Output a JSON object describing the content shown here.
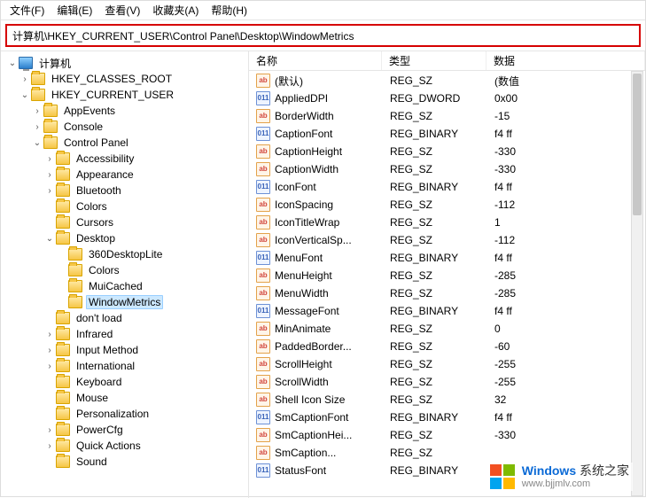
{
  "menu": {
    "file": "文件(F)",
    "edit": "编辑(E)",
    "view": "查看(V)",
    "fav": "收藏夹(A)",
    "help": "帮助(H)"
  },
  "address": "计算机\\HKEY_CURRENT_USER\\Control Panel\\Desktop\\WindowMetrics",
  "tree": {
    "root": "计算机",
    "hkcr": "HKEY_CLASSES_ROOT",
    "hkcu": "HKEY_CURRENT_USER",
    "appevents": "AppEvents",
    "console": "Console",
    "cpanel": "Control Panel",
    "access": "Accessibility",
    "appear": "Appearance",
    "bluetooth": "Bluetooth",
    "colors": "Colors",
    "cursors": "Cursors",
    "desktop": "Desktop",
    "d360": "360DesktopLite",
    "dcolors": "Colors",
    "mui": "MuiCached",
    "wm": "WindowMetrics",
    "dontload": "don't load",
    "infrared": "Infrared",
    "inputm": "Input Method",
    "intl": "International",
    "kbd": "Keyboard",
    "mouse": "Mouse",
    "pers": "Personalization",
    "power": "PowerCfg",
    "qa": "Quick Actions",
    "sound": "Sound"
  },
  "columns": {
    "name": "名称",
    "type": "类型",
    "data": "数据"
  },
  "values": [
    {
      "icon": "str",
      "name": "(默认)",
      "type": "REG_SZ",
      "data": "(数值"
    },
    {
      "icon": "bin",
      "name": "AppliedDPI",
      "type": "REG_DWORD",
      "data": "0x00"
    },
    {
      "icon": "str",
      "name": "BorderWidth",
      "type": "REG_SZ",
      "data": "-15"
    },
    {
      "icon": "bin",
      "name": "CaptionFont",
      "type": "REG_BINARY",
      "data": "f4 ff"
    },
    {
      "icon": "str",
      "name": "CaptionHeight",
      "type": "REG_SZ",
      "data": "-330"
    },
    {
      "icon": "str",
      "name": "CaptionWidth",
      "type": "REG_SZ",
      "data": "-330"
    },
    {
      "icon": "bin",
      "name": "IconFont",
      "type": "REG_BINARY",
      "data": "f4 ff"
    },
    {
      "icon": "str",
      "name": "IconSpacing",
      "type": "REG_SZ",
      "data": "-112"
    },
    {
      "icon": "str",
      "name": "IconTitleWrap",
      "type": "REG_SZ",
      "data": "1"
    },
    {
      "icon": "str",
      "name": "IconVerticalSp...",
      "type": "REG_SZ",
      "data": "-112"
    },
    {
      "icon": "bin",
      "name": "MenuFont",
      "type": "REG_BINARY",
      "data": "f4 ff"
    },
    {
      "icon": "str",
      "name": "MenuHeight",
      "type": "REG_SZ",
      "data": "-285"
    },
    {
      "icon": "str",
      "name": "MenuWidth",
      "type": "REG_SZ",
      "data": "-285"
    },
    {
      "icon": "bin",
      "name": "MessageFont",
      "type": "REG_BINARY",
      "data": "f4 ff"
    },
    {
      "icon": "str",
      "name": "MinAnimate",
      "type": "REG_SZ",
      "data": "0"
    },
    {
      "icon": "str",
      "name": "PaddedBorder...",
      "type": "REG_SZ",
      "data": "-60"
    },
    {
      "icon": "str",
      "name": "ScrollHeight",
      "type": "REG_SZ",
      "data": "-255"
    },
    {
      "icon": "str",
      "name": "ScrollWidth",
      "type": "REG_SZ",
      "data": "-255"
    },
    {
      "icon": "str",
      "name": "Shell Icon Size",
      "type": "REG_SZ",
      "data": "32"
    },
    {
      "icon": "bin",
      "name": "SmCaptionFont",
      "type": "REG_BINARY",
      "data": "f4 ff"
    },
    {
      "icon": "str",
      "name": "SmCaptionHei...",
      "type": "REG_SZ",
      "data": "-330"
    },
    {
      "icon": "str",
      "name": "SmCaption...",
      "type": "REG_SZ",
      "data": ""
    },
    {
      "icon": "bin",
      "name": "StatusFont",
      "type": "REG_BINARY",
      "data": ""
    }
  ],
  "watermark": {
    "line1a": "Windows",
    "line1b": " 系统之家",
    "line2": "www.bjjmlv.com"
  }
}
